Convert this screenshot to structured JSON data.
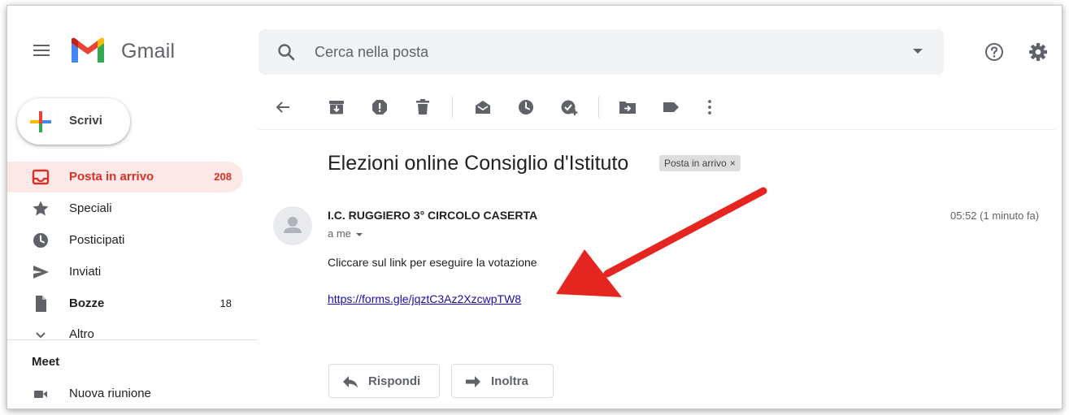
{
  "app": {
    "name": "Gmail",
    "brand_colors": {
      "red": "#ea4335",
      "blue": "#4285f4",
      "green": "#34a853",
      "yellow": "#fbbc04"
    }
  },
  "search": {
    "placeholder": "Cerca nella posta",
    "icon": "search-icon"
  },
  "header_actions": [
    {
      "name": "help-icon"
    },
    {
      "name": "gear-icon"
    }
  ],
  "compose": {
    "label": "Scrivi",
    "icon": "plus-icon"
  },
  "sidebar": {
    "items": [
      {
        "label": "Posta in arrivo",
        "count": "208",
        "icon": "inbox-icon",
        "active": true
      },
      {
        "label": "Speciali",
        "count": "",
        "icon": "star-icon"
      },
      {
        "label": "Posticipati",
        "count": "",
        "icon": "clock-icon"
      },
      {
        "label": "Inviati",
        "count": "",
        "icon": "send-icon"
      },
      {
        "label": "Bozze",
        "count": "18",
        "icon": "draft-icon"
      },
      {
        "label": "Altro",
        "count": "",
        "icon": "chevron-down-icon"
      }
    ],
    "meet": {
      "title": "Meet",
      "items": [
        {
          "label": "Nuova riunione",
          "icon": "video-icon"
        }
      ]
    }
  },
  "toolbar": {
    "icons": [
      "back-arrow-icon",
      "archive-icon",
      "report-spam-icon",
      "delete-icon",
      "mark-unread-icon",
      "snooze-icon",
      "add-task-icon",
      "move-to-icon",
      "label-icon",
      "more-vert-icon"
    ]
  },
  "message": {
    "subject": "Elezioni online Consiglio d'Istituto",
    "label_chip": "Posta in arrivo",
    "label_chip_close": "×",
    "sender": "I.C. RUGGIERO 3° CIRCOLO CASERTA",
    "recipient": "a me",
    "time": "05:52 (1 minuto fa)",
    "body": "Cliccare sul link per eseguire la votazione",
    "link": "https://forms.gle/jqztC3Az2XzcwpTW8",
    "annotation_color": "#e52620"
  },
  "actions": {
    "reply": "Rispondi",
    "forward": "Inoltra"
  }
}
